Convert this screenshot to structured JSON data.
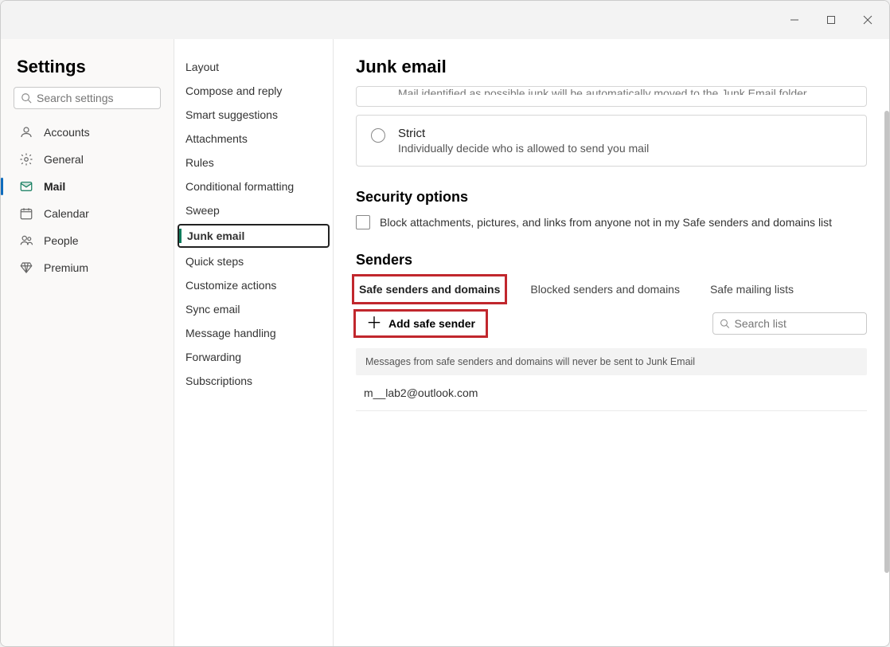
{
  "window": {
    "settings_title": "Settings",
    "search_placeholder": "Search settings"
  },
  "sidebar": {
    "items": [
      {
        "label": "Accounts"
      },
      {
        "label": "General"
      },
      {
        "label": "Mail"
      },
      {
        "label": "Calendar"
      },
      {
        "label": "People"
      },
      {
        "label": "Premium"
      }
    ],
    "active": "Mail"
  },
  "subnav": {
    "items": [
      {
        "label": "Layout"
      },
      {
        "label": "Compose and reply"
      },
      {
        "label": "Smart suggestions"
      },
      {
        "label": "Attachments"
      },
      {
        "label": "Rules"
      },
      {
        "label": "Conditional formatting"
      },
      {
        "label": "Sweep"
      },
      {
        "label": "Junk email"
      },
      {
        "label": "Quick steps"
      },
      {
        "label": "Customize actions"
      },
      {
        "label": "Sync email"
      },
      {
        "label": "Message handling"
      },
      {
        "label": "Forwarding"
      },
      {
        "label": "Subscriptions"
      }
    ],
    "active": "Junk email"
  },
  "page": {
    "title": "Junk email",
    "filter_auto_desc": "Mail identified as possible junk will be automatically moved to the Junk Email folder",
    "strict_title": "Strict",
    "strict_desc": "Individually decide who is allowed to send you mail",
    "security_section": "Security options",
    "security_block_label": "Block attachments, pictures, and links from anyone not in my Safe senders and domains list",
    "senders_section": "Senders",
    "tabs": {
      "safe": "Safe senders and domains",
      "blocked": "Blocked senders and domains",
      "mailing": "Safe mailing lists",
      "active": "safe"
    },
    "add_button": "Add safe sender",
    "search_list_placeholder": "Search list",
    "infobar": "Messages from safe senders and domains will never be sent to Junk Email",
    "safe_senders": [
      "m__lab2@outlook.com"
    ]
  }
}
